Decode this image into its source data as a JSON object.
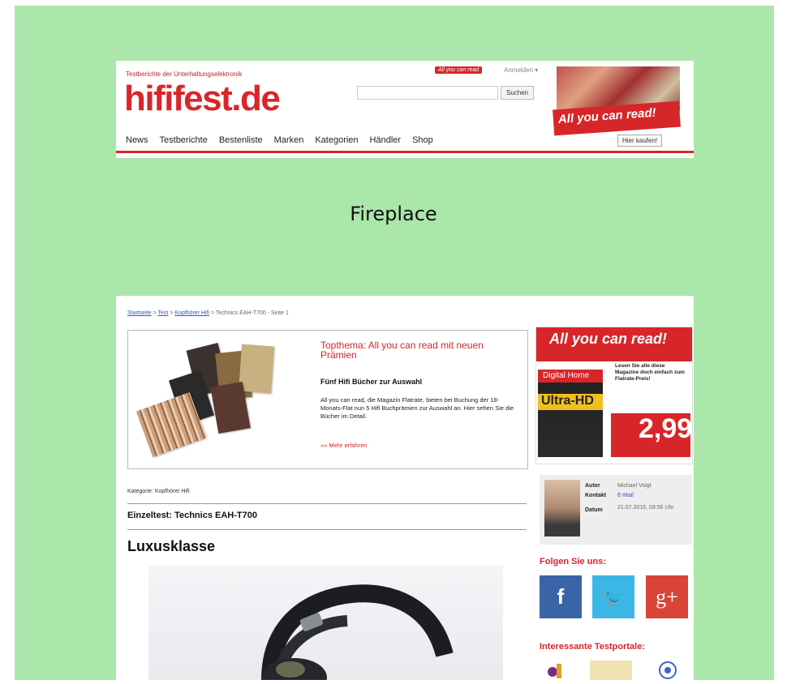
{
  "header": {
    "tagline": "Testberichte der Unterhaltungselektronik",
    "logo": "hififest.de",
    "ayc_badge": "All you can read",
    "login": "Anmelden ▾",
    "search_button": "Suchen",
    "nav": [
      "News",
      "Testberichte",
      "Bestenliste",
      "Marken",
      "Kategorien",
      "Händler",
      "Shop"
    ],
    "ad_text": "All you can read!",
    "ad_button": "Hier kaufen!"
  },
  "fireplace_label": "Fireplace",
  "breadcrumb": {
    "links": [
      "Startseite",
      "Test",
      "Kopfhörer Hifi"
    ],
    "current": "Technics EAH-T700 - Seite 1"
  },
  "topthema": {
    "title": "Topthema: All you can read mit neuen Prämien",
    "subtitle": "Fünf Hifi Bücher zur Auswahl",
    "text": "All you can read, die Magazin Flatrate, bieten bei Buchung der 18-Monats-Flat nun 5 Hifi Buchprämien zur Auswahl an. Hier sehen Sie die Bücher im Detail.",
    "more": "»» Mehr erfahren"
  },
  "article": {
    "category": "Kategorie: Kopfhörer Hifi",
    "test_title": "Einzeltest: Technics EAH-T700",
    "headline": "Luxusklasse"
  },
  "sidebar_ad": {
    "head": "All you can read!",
    "mag_title": "Digital Home",
    "mag_badge": "Ultra-HD",
    "text": "Lesen Sie alle diese Magazine doch einfach zum Flatrate-Preis!",
    "price": "2,99"
  },
  "author": {
    "labels": [
      "Autor",
      "Kontakt",
      "Datum"
    ],
    "values": [
      "Michael Voigt",
      "E-Mail",
      "21.07.2016, 09:56 Uhr"
    ]
  },
  "social": {
    "title": "Folgen Sie uns:",
    "buttons": [
      {
        "label": "f",
        "color": "#3b64a8"
      },
      {
        "label": "🐦",
        "color": "#3bb6e6"
      },
      {
        "label": "g+",
        "color": "#d94436"
      }
    ]
  },
  "portale_title": "Interessante Testportale:"
}
